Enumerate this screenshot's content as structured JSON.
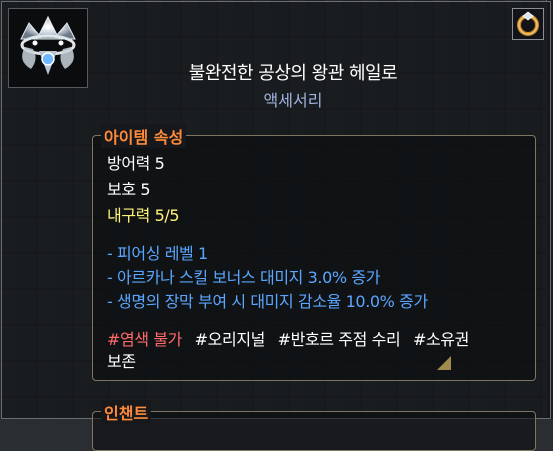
{
  "item": {
    "name": "불완전한 공상의 왕관 헤일로",
    "category": "액세서리",
    "icon": "crown-halo-icon",
    "corner_icon": "ring-icon"
  },
  "attributes": {
    "header": "아이템 속성",
    "defense": "방어력 5",
    "protection": "보호 5",
    "durability": "내구력 5/5",
    "effects": [
      "- 피어싱 레벨 1",
      "- 아르카나 스킬 보너스 대미지 3.0% 증가",
      "- 생명의 장막 부여 시 대미지 감소율 10.0% 증가"
    ],
    "tags": [
      {
        "text": "#염색 불가",
        "color": "#ff6a6a"
      },
      {
        "text": "#오리지널",
        "color": "#ffffff"
      },
      {
        "text": "#반호르 주점 수리",
        "color": "#ffffff"
      },
      {
        "text": "#소유권",
        "color": "#ffffff"
      }
    ],
    "tags_overflow": "보존"
  },
  "enchant": {
    "header": "인챈트"
  }
}
